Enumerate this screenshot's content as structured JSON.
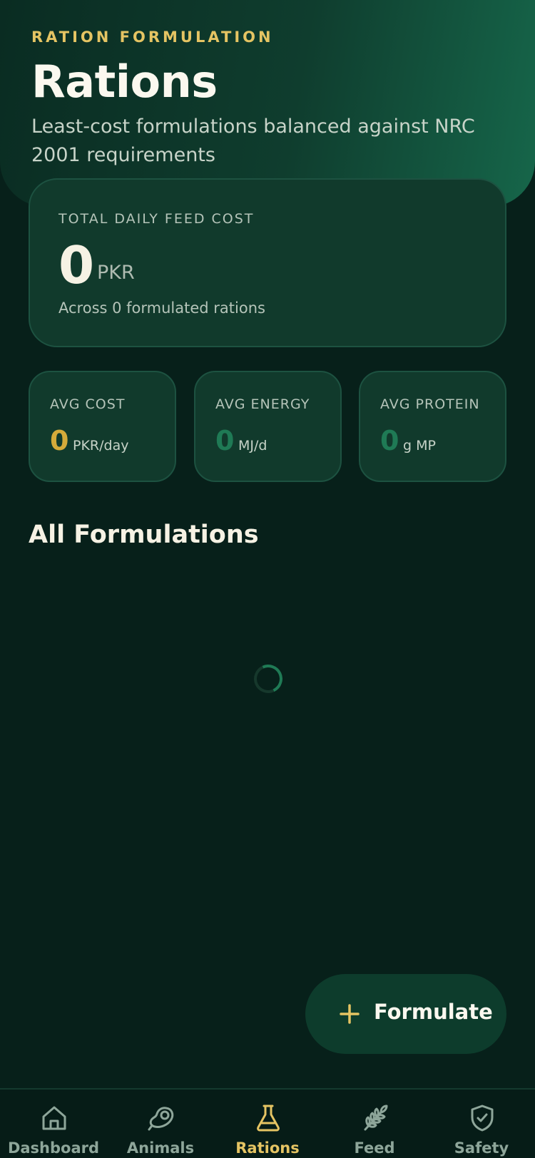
{
  "header": {
    "eyebrow": "RATION FORMULATION",
    "title": "Rations",
    "subtitle": "Least-cost formulations balanced against NRC 2001 requirements"
  },
  "total_card": {
    "label": "TOTAL DAILY FEED COST",
    "value": "0",
    "unit": "PKR",
    "note": "Across 0 formulated rations"
  },
  "stats": [
    {
      "label": "AVG COST",
      "value": "0",
      "unit": "PKR/day",
      "color": "#d5ab3a"
    },
    {
      "label": "AVG ENERGY",
      "value": "0",
      "unit": "MJ/d",
      "color": "#1f7a55"
    },
    {
      "label": "AVG PROTEIN",
      "value": "0",
      "unit": "g MP",
      "color": "#1f7a55"
    }
  ],
  "section": {
    "title": "All Formulations"
  },
  "fab": {
    "label": "Formulate",
    "icon": "plus-icon"
  },
  "tabs": [
    {
      "label": "Dashboard",
      "icon": "home-icon",
      "active": false
    },
    {
      "label": "Animals",
      "icon": "meat-icon",
      "active": false
    },
    {
      "label": "Rations",
      "icon": "flask-icon",
      "active": true
    },
    {
      "label": "Feed",
      "icon": "wheat-icon",
      "active": false
    },
    {
      "label": "Safety",
      "icon": "shield-check-icon",
      "active": false
    }
  ],
  "colors": {
    "background": "#07201a",
    "accent_gold": "#e5c463",
    "accent_green": "#1f7a55",
    "card": "#113a2c"
  }
}
